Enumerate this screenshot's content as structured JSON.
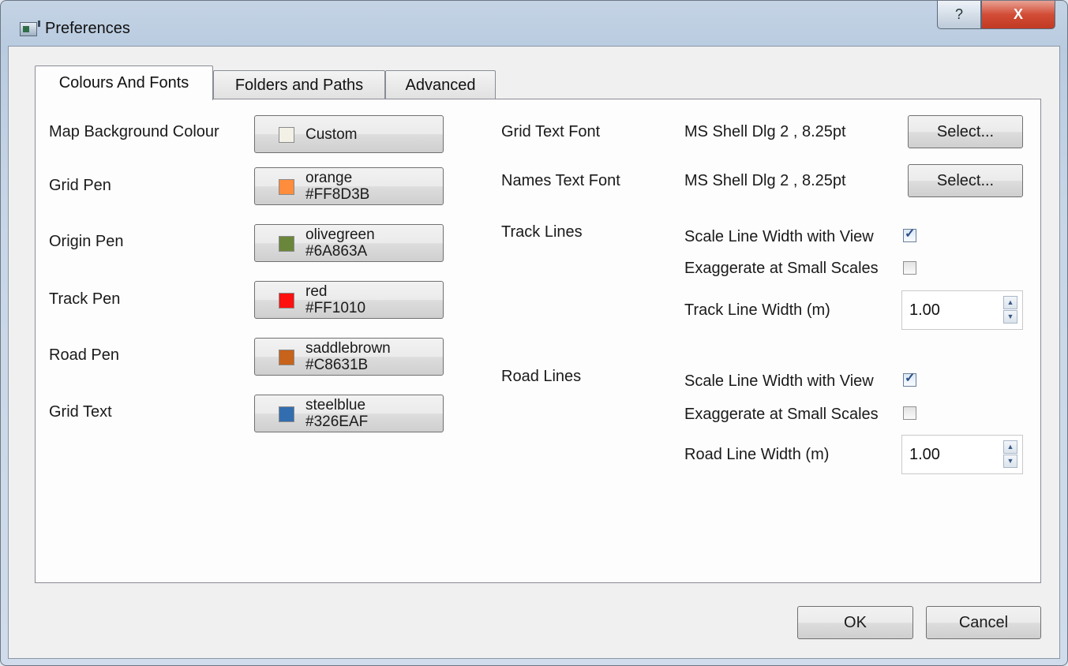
{
  "window": {
    "title": "Preferences",
    "help_glyph": "?",
    "close_glyph": "X"
  },
  "tabs": [
    {
      "label": "Colours And Fonts",
      "active": true
    },
    {
      "label": "Folders and Paths",
      "active": false
    },
    {
      "label": "Advanced",
      "active": false
    }
  ],
  "colors": {
    "map_background": {
      "label": "Map Background Colour",
      "button_name": "Custom",
      "button_code": "",
      "swatch": "#F3F0E6"
    },
    "grid_pen": {
      "label": "Grid Pen",
      "button_name": "orange",
      "button_code": "#FF8D3B",
      "swatch": "#FF8D3B"
    },
    "origin_pen": {
      "label": "Origin Pen",
      "button_name": "olivegreen",
      "button_code": "#6A863A",
      "swatch": "#6A863A"
    },
    "track_pen": {
      "label": "Track Pen",
      "button_name": "red",
      "button_code": "#FF1010",
      "swatch": "#FF1010"
    },
    "road_pen": {
      "label": "Road Pen",
      "button_name": "saddlebrown",
      "button_code": "#C8631B",
      "swatch": "#C8631B"
    },
    "grid_text": {
      "label": "Grid Text",
      "button_name": "steelblue",
      "button_code": "#326EAF",
      "swatch": "#326EAF"
    }
  },
  "fonts": {
    "grid_text_font": {
      "label": "Grid Text Font",
      "value": "MS Shell Dlg 2 , 8.25pt",
      "button": "Select..."
    },
    "names_text_font": {
      "label": "Names Text Font",
      "value": "MS Shell Dlg 2 , 8.25pt",
      "button": "Select..."
    }
  },
  "track_lines": {
    "label": "Track Lines",
    "scale_with_view": {
      "label": "Scale Line Width with View",
      "checked": true
    },
    "exaggerate": {
      "label": "Exaggerate at Small Scales",
      "checked": false
    },
    "width": {
      "label": "Track Line Width (m)",
      "value": "1.00"
    }
  },
  "road_lines": {
    "label": "Road Lines",
    "scale_with_view": {
      "label": "Scale Line Width with View",
      "checked": true
    },
    "exaggerate": {
      "label": "Exaggerate at Small Scales",
      "checked": false
    },
    "width": {
      "label": "Road Line Width (m)",
      "value": "1.00"
    }
  },
  "footer": {
    "ok": "OK",
    "cancel": "Cancel"
  },
  "icons": {
    "check_glyph": "✓",
    "spin_up_glyph": "▲",
    "spin_down_glyph": "▼"
  }
}
